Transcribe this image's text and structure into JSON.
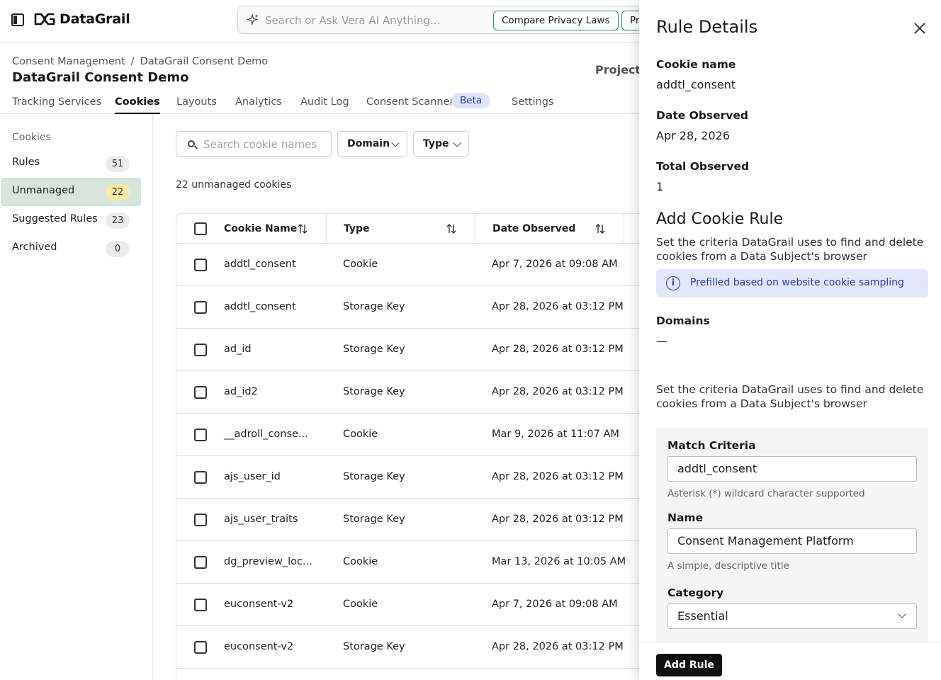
{
  "app": {
    "brand": "DataGrail"
  },
  "search": {
    "placeholder": "Search or Ask Vera AI Anything...",
    "actions": [
      "Compare Privacy Laws",
      "Pr"
    ]
  },
  "breadcrumb": [
    "Consent Management",
    "/",
    "DataGrail Consent Demo"
  ],
  "page": {
    "title": "DataGrail Consent Demo",
    "project_label": "Project:"
  },
  "tabs": [
    {
      "label": "Tracking Services"
    },
    {
      "label": "Cookies",
      "active": true
    },
    {
      "label": "Layouts"
    },
    {
      "label": "Analytics"
    },
    {
      "label": "Audit Log"
    },
    {
      "label": "Consent Scanner",
      "badge": "Beta"
    },
    {
      "label": "Settings"
    }
  ],
  "sidebar": {
    "heading": "Cookies",
    "items": [
      {
        "label": "Rules",
        "count": "51"
      },
      {
        "label": "Unmanaged",
        "count": "22",
        "active": true
      },
      {
        "label": "Suggested Rules",
        "count": "23"
      },
      {
        "label": "Archived",
        "count": "0"
      }
    ]
  },
  "filters": {
    "search_placeholder": "Search cookie names",
    "domain": "Domain",
    "type": "Type"
  },
  "summary": "22 unmanaged cookies",
  "table": {
    "headers": [
      "Cookie Name",
      "Type",
      "Date Observed"
    ],
    "rows": [
      [
        "addtl_consent",
        "Cookie",
        "Apr 7, 2026 at 09:08 AM"
      ],
      [
        "addtl_consent",
        "Storage Key",
        "Apr 28, 2026 at 03:12 PM"
      ],
      [
        "ad_id",
        "Storage Key",
        "Apr 28, 2026 at 03:12 PM"
      ],
      [
        "ad_id2",
        "Storage Key",
        "Apr 28, 2026 at 03:12 PM"
      ],
      [
        "__adroll_conse...",
        "Cookie",
        "Mar 9, 2026 at 11:07 AM"
      ],
      [
        "ajs_user_id",
        "Storage Key",
        "Apr 28, 2026 at 03:12 PM"
      ],
      [
        "ajs_user_traits",
        "Storage Key",
        "Apr 28, 2026 at 03:12 PM"
      ],
      [
        "dg_preview_loc...",
        "Cookie",
        "Mar 13, 2026 at 10:05 AM"
      ],
      [
        "euconsent-v2",
        "Cookie",
        "Apr 7, 2026 at 09:08 AM"
      ],
      [
        "euconsent-v2",
        "Storage Key",
        "Apr 28, 2026 at 03:12 PM"
      ]
    ]
  },
  "panel": {
    "title": "Rule Details",
    "cookie_name_label": "Cookie name",
    "cookie_name": "addtl_consent",
    "date_observed_label": "Date Observed",
    "date_observed": "Apr 28, 2026",
    "total_observed_label": "Total Observed",
    "total_observed": "1",
    "add_rule_title": "Add Cookie Rule",
    "criteria_desc": "Set the criteria DataGrail uses to find and delete cookies from a Data Subject's browser",
    "info_note": "Prefilled based on website cookie sampling",
    "domains_label": "Domains",
    "domains_value": "—",
    "criteria_desc2": "Set the criteria DataGrail uses to find and delete cookies from a Data Subject's browser",
    "match_label": "Match Criteria",
    "match_value": "addtl_consent",
    "match_help": "Asterisk (*) wildcard character supported",
    "name_label": "Name",
    "name_value": "Consent Management Platform",
    "name_help": "A simple, descriptive title",
    "category_label": "Category",
    "category_value": "Essential",
    "add_button": "Add Rule"
  },
  "colors": {
    "active_nav": "#d7e6d9",
    "badge_yellow": "#fbe8a7",
    "info_bg": "#e4e7fb",
    "accent_green": "#2f8f5c"
  }
}
